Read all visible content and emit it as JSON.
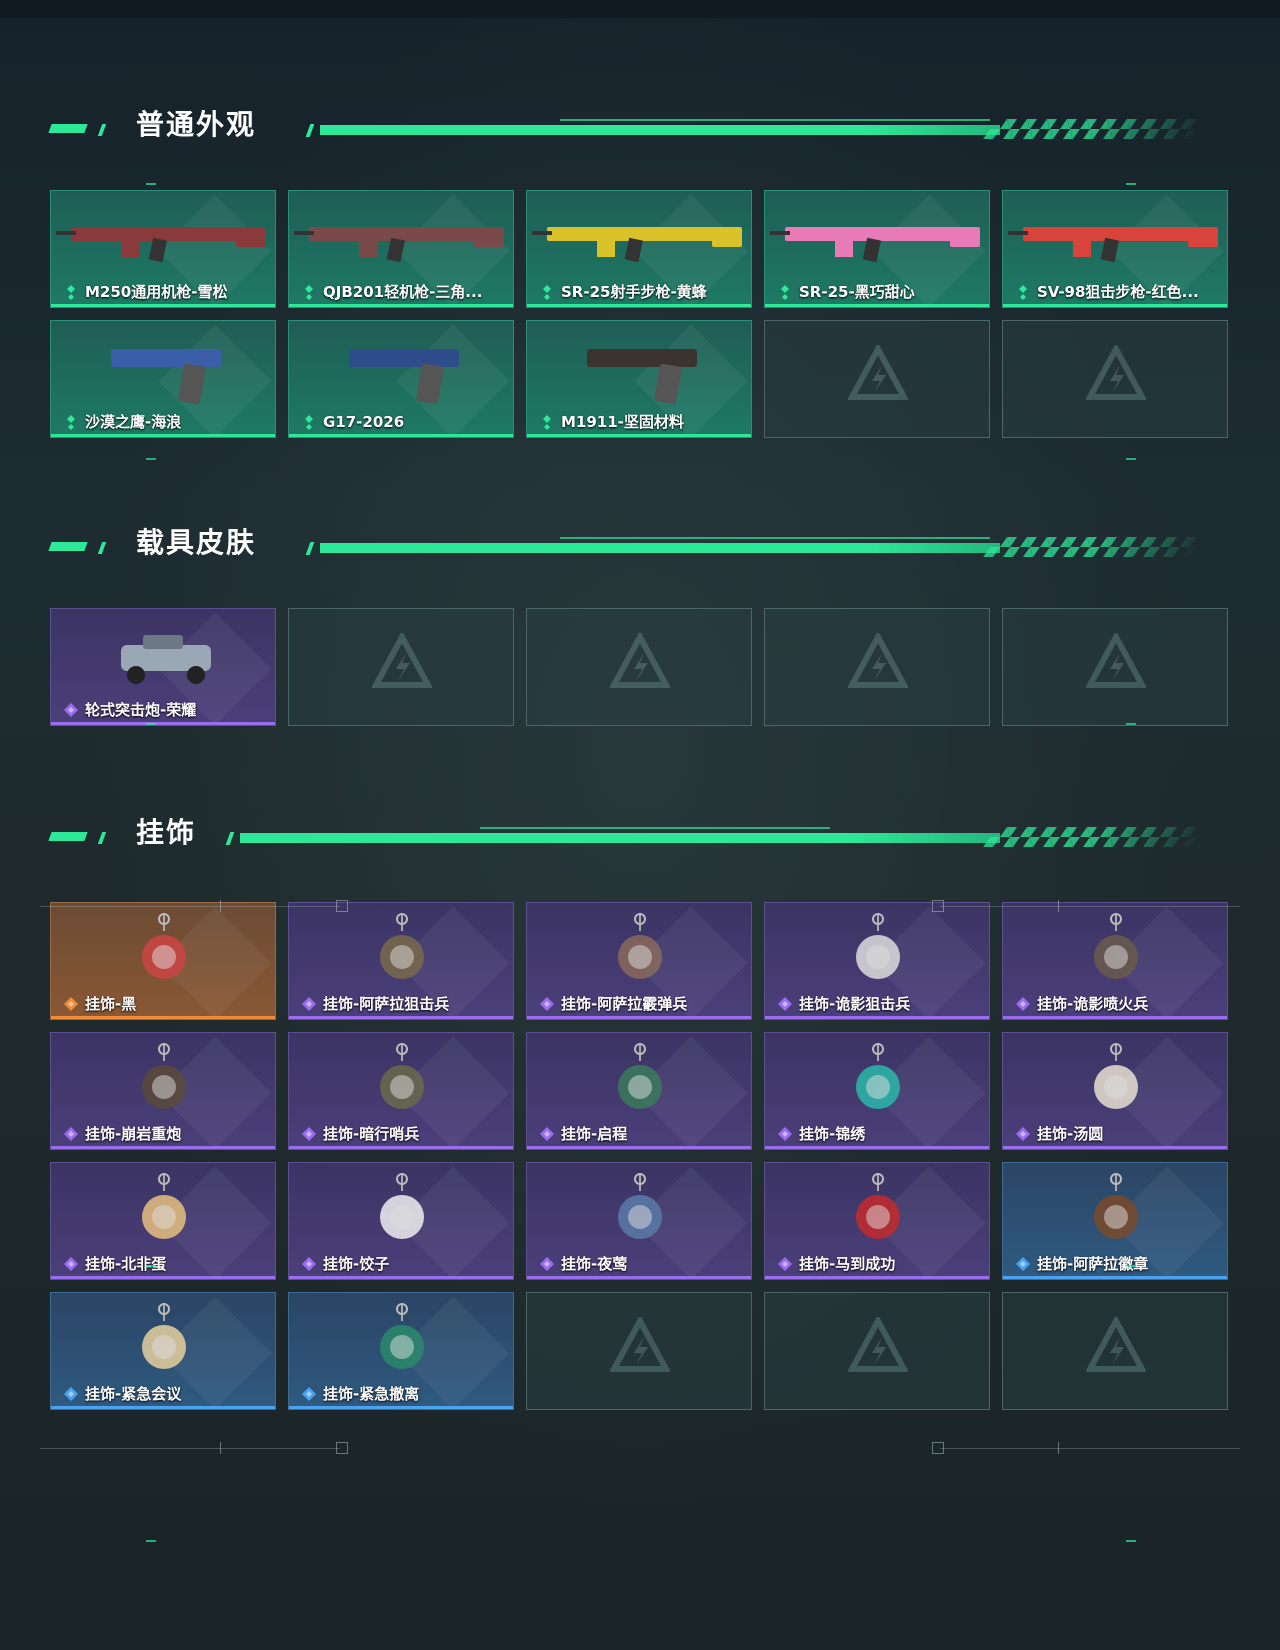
{
  "sections": [
    {
      "title": "普通外观",
      "items": [
        {
          "name": "M250通用机枪-雪松",
          "rarity": "green",
          "icon": "machine-gun"
        },
        {
          "name": "QJB201轻机枪-三角...",
          "rarity": "green",
          "icon": "light-machine-gun"
        },
        {
          "name": "SR-25射手步枪-黄蜂",
          "rarity": "green",
          "icon": "marksman-rifle"
        },
        {
          "name": "SR-25-黑巧甜心",
          "rarity": "green",
          "icon": "marksman-rifle"
        },
        {
          "name": "SV-98狙击步枪-红色...",
          "rarity": "green",
          "icon": "sniper-rifle"
        },
        {
          "name": "沙漠之鹰-海浪",
          "rarity": "green",
          "icon": "pistol"
        },
        {
          "name": "G17-2026",
          "rarity": "green",
          "icon": "pistol"
        },
        {
          "name": "M1911-坚固材料",
          "rarity": "green",
          "icon": "pistol"
        },
        {
          "empty": true
        },
        {
          "empty": true
        }
      ]
    },
    {
      "title": "载具皮肤",
      "items": [
        {
          "name": "轮式突击炮-荣耀",
          "rarity": "purple",
          "icon": "vehicle"
        },
        {
          "empty": true
        },
        {
          "empty": true
        },
        {
          "empty": true
        },
        {
          "empty": true
        }
      ]
    },
    {
      "title": "挂饰",
      "items": [
        {
          "name": "挂饰-黑",
          "rarity": "orange",
          "icon": "charm"
        },
        {
          "name": "挂饰-阿萨拉狙击兵",
          "rarity": "purple",
          "icon": "charm"
        },
        {
          "name": "挂饰-阿萨拉霰弹兵",
          "rarity": "purple",
          "icon": "charm"
        },
        {
          "name": "挂饰-诡影狙击兵",
          "rarity": "purple",
          "icon": "charm"
        },
        {
          "name": "挂饰-诡影喷火兵",
          "rarity": "purple",
          "icon": "charm"
        },
        {
          "name": "挂饰-崩岩重炮",
          "rarity": "purple",
          "icon": "charm"
        },
        {
          "name": "挂饰-暗行哨兵",
          "rarity": "purple",
          "icon": "charm"
        },
        {
          "name": "挂饰-启程",
          "rarity": "purple",
          "icon": "charm"
        },
        {
          "name": "挂饰-锦绣",
          "rarity": "purple",
          "icon": "charm"
        },
        {
          "name": "挂饰-汤圆",
          "rarity": "purple",
          "icon": "charm"
        },
        {
          "name": "挂饰-北非蛋",
          "rarity": "purple",
          "icon": "charm"
        },
        {
          "name": "挂饰-饺子",
          "rarity": "purple",
          "icon": "charm"
        },
        {
          "name": "挂饰-夜莺",
          "rarity": "purple",
          "icon": "charm"
        },
        {
          "name": "挂饰-马到成功",
          "rarity": "purple",
          "icon": "charm"
        },
        {
          "name": "挂饰-阿萨拉徽章",
          "rarity": "blue",
          "icon": "charm"
        },
        {
          "name": "挂饰-紧急会议",
          "rarity": "blue",
          "icon": "charm"
        },
        {
          "name": "挂饰-紧急撤离",
          "rarity": "blue",
          "icon": "charm"
        },
        {
          "empty": true
        },
        {
          "empty": true
        },
        {
          "empty": true
        }
      ]
    }
  ],
  "colors": {
    "accent": "#2ee89a",
    "green": "#2ee89a",
    "purple": "#9a6cf0",
    "orange": "#f08a3a",
    "blue": "#4aa2f0"
  }
}
